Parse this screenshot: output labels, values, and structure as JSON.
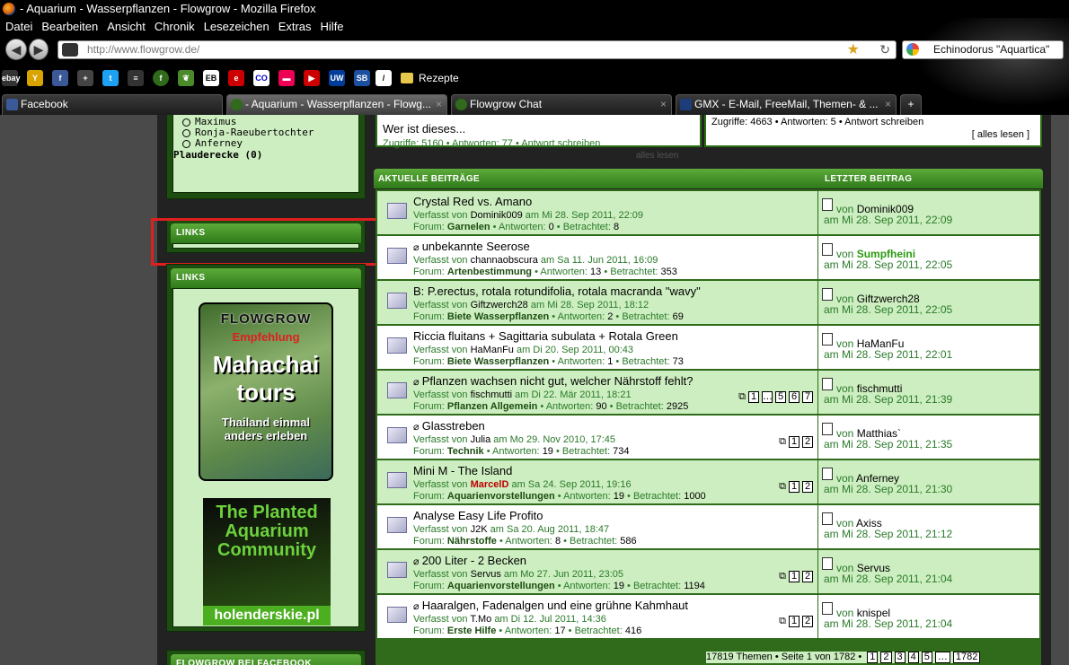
{
  "window": {
    "title": "- Aquarium - Wasserpflanzen - Flowgrow - Mozilla Firefox"
  },
  "menu": [
    "Datei",
    "Bearbeiten",
    "Ansicht",
    "Chronik",
    "Lesezeichen",
    "Extras",
    "Hilfe"
  ],
  "navbar": {
    "url": "http://www.flowgrow.de/",
    "search_value": "Echinodorus \"Aquartica\""
  },
  "bookmarks": {
    "folder_label": "Rezepte",
    "icons": [
      "ebay-icon",
      "yahoo-icon",
      "facebook-icon",
      "plus-icon",
      "twitter-icon",
      "chat-icon",
      "flowgrow-icon",
      "leaf-icon",
      "eb-icon",
      "ebay2-icon",
      "co-icon",
      "flag-icon",
      "youtube-icon",
      "uw-icon",
      "sb-icon",
      "pen-icon"
    ]
  },
  "tabs": [
    {
      "label": "Facebook",
      "color": "#3b5998"
    },
    {
      "label": "- Aquarium - Wasserpflanzen - Flowg...",
      "color": "#2f6b1a"
    },
    {
      "label": "Flowgrow Chat",
      "color": "#2f6b1a"
    },
    {
      "label": "GMX - E-Mail, FreeMail, Themen- & ...",
      "color": "#1c3d7a"
    }
  ],
  "sidebar": {
    "users": [
      "Maximus",
      "Ronja-Raeubertochter",
      "Anferney"
    ],
    "plauderecke": "Plauderecke (0)",
    "links_header_1": "LINKS",
    "links_header_2": "LINKS",
    "ad1": {
      "l1": "FLOWGROW",
      "l2": "Empfehlung",
      "l3": "Mahachai",
      "l4": "tours",
      "l5": "Thailand einmal",
      "l6": "anders erleben"
    },
    "ad2": {
      "l1": "The Planted",
      "l2": "Aquarium",
      "l3": "Community",
      "l4": "holenderskie.pl"
    },
    "facebook_header": "FLOWGROW BEI FACEBOOK"
  },
  "topboxes": {
    "left_title": "Wer ist dieses...",
    "left_stats": "Zugriffe: 5160  •  Antworten: 77  •  Antwort schreiben",
    "right_stats": "Zugriffe: 4663  •  Antworten: 5  •  Antwort schreiben",
    "right_more": "[ alles lesen ]",
    "alles_lesen": "alles lesen"
  },
  "posts_header": {
    "left": "AKTUELLE BEITRÄGE",
    "right": "LETZTER BEITRAG"
  },
  "labels": {
    "by": "Verfasst von",
    "forum": "Forum:",
    "answers": "Antworten:",
    "views": "Betrachtet:",
    "from": "von"
  },
  "posts": [
    {
      "title": "Crystal Red vs. Amano",
      "author": "Dominik009",
      "date": "am Mi 28. Sep 2011, 22:09",
      "forum": "Garnelen",
      "answers": "0",
      "views": "8",
      "last_by": "Dominik009",
      "last_date": "am Mi 28. Sep 2011, 22:09",
      "attach": false,
      "pages": []
    },
    {
      "title": "unbekannte Seerose",
      "author": "channaobscura",
      "date": "am Sa 11. Jun 2011, 16:09",
      "forum": "Artenbestimmung",
      "answers": "13",
      "views": "353",
      "last_by": "Sumpfheini",
      "last_date": "am Mi 28. Sep 2011, 22:05",
      "attach": true,
      "pages": []
    },
    {
      "title": "B: P.erectus, rotala rotundifolia, rotala macranda \"wavy\"",
      "author": "Giftzwerch28",
      "date": "am Mi 28. Sep 2011, 18:12",
      "forum": "Biete Wasserpflanzen",
      "answers": "2",
      "views": "69",
      "last_by": "Giftzwerch28",
      "last_date": "am Mi 28. Sep 2011, 22:05",
      "attach": false,
      "pages": []
    },
    {
      "title": "Riccia fluitans + Sagittaria subulata + Rotala Green",
      "author": "HaManFu",
      "date": "am Di 20. Sep 2011, 00:43",
      "forum": "Biete Wasserpflanzen",
      "answers": "1",
      "views": "73",
      "last_by": "HaManFu",
      "last_date": "am Mi 28. Sep 2011, 22:01",
      "attach": false,
      "pages": []
    },
    {
      "title": "Pflanzen wachsen nicht gut, welcher Nährstoff fehlt?",
      "author": "fischmutti",
      "date": "am Di 22. Mär 2011, 18:21",
      "forum": "Pflanzen Allgemein",
      "answers": "90",
      "views": "2925",
      "last_by": "fischmutti",
      "last_date": "am Mi 28. Sep 2011, 21:39",
      "attach": true,
      "pages": [
        "1",
        "…",
        "5",
        "6",
        "7"
      ]
    },
    {
      "title": "Glasstreben",
      "author": "Julia",
      "date": "am Mo 29. Nov 2010, 17:45",
      "forum": "Technik",
      "answers": "19",
      "views": "734",
      "last_by": "Matthias`",
      "last_date": "am Mi 28. Sep 2011, 21:35",
      "attach": true,
      "pages": [
        "1",
        "2"
      ]
    },
    {
      "title": "Mini M - The Island",
      "author": "MarcelD",
      "date": "am Sa 24. Sep 2011, 19:16",
      "forum": "Aquarienvorstellungen",
      "answers": "19",
      "views": "1000",
      "last_by": "Anferney",
      "last_date": "am Mi 28. Sep 2011, 21:30",
      "attach": false,
      "pages": [
        "1",
        "2"
      ]
    },
    {
      "title": "Analyse Easy Life Profito",
      "author": "J2K",
      "date": "am Sa 20. Aug 2011, 18:47",
      "forum": "Nährstoffe",
      "answers": "8",
      "views": "586",
      "last_by": "Axiss",
      "last_date": "am Mi 28. Sep 2011, 21:12",
      "attach": false,
      "pages": []
    },
    {
      "title": "200 Liter - 2 Becken",
      "author": "Servus",
      "date": "am Mo 27. Jun 2011, 23:05",
      "forum": "Aquarienvorstellungen",
      "answers": "19",
      "views": "1194",
      "last_by": "Servus",
      "last_date": "am Mi 28. Sep 2011, 21:04",
      "attach": true,
      "pages": [
        "1",
        "2"
      ]
    },
    {
      "title": "Haaralgen, Fadenalgen und eine grühne Kahmhaut",
      "author": "T.Mo",
      "date": "am Di 12. Jul 2011, 14:36",
      "forum": "Erste Hilfe",
      "answers": "17",
      "views": "416",
      "last_by": "knispel",
      "last_date": "am Mi 28. Sep 2011, 21:04",
      "attach": true,
      "pages": [
        "1",
        "2"
      ]
    }
  ],
  "footer": {
    "text": "17819 Themen • Seite 1 von 1782 •",
    "pages": [
      "1",
      "2",
      "3",
      "4",
      "5",
      "…",
      "1782"
    ]
  },
  "colors": {
    "accent": "#2f6b1a",
    "highlight": "#e01f1f",
    "row_alt": "#cdeec0"
  }
}
